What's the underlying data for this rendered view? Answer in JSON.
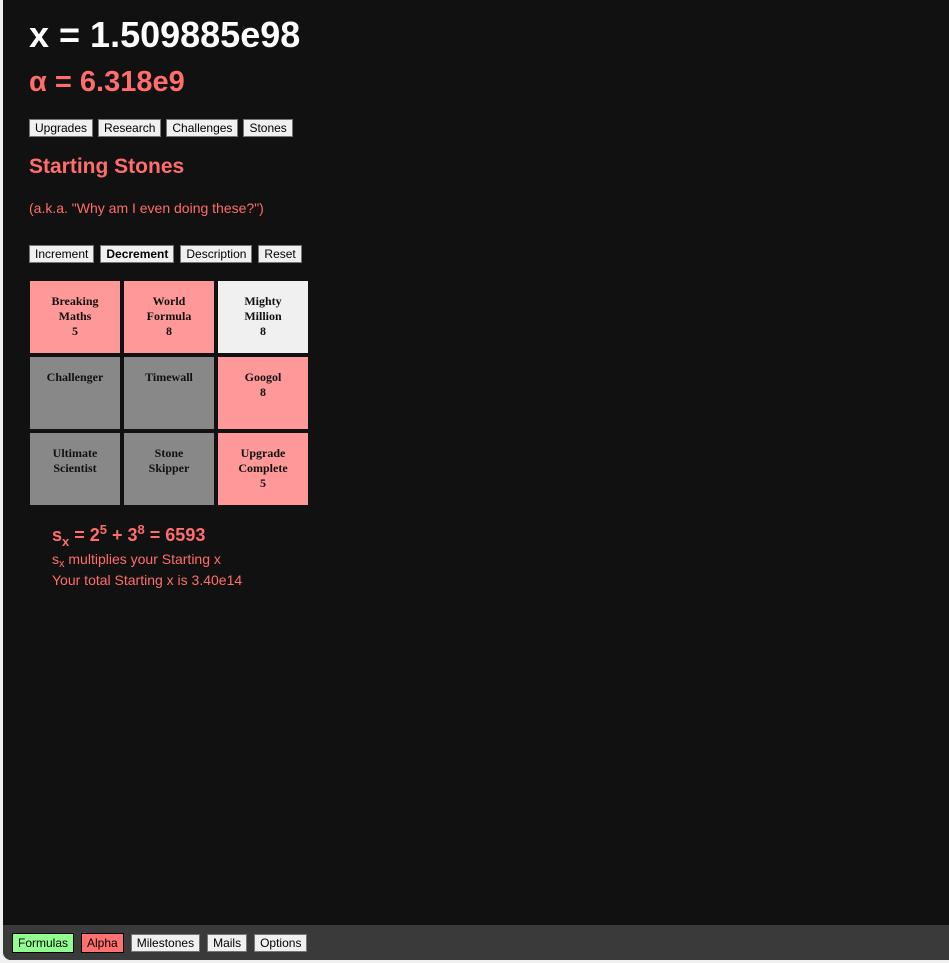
{
  "header": {
    "x_text": "x = 1.509885e98",
    "alpha_text": "α = 6.318e9"
  },
  "tabs": [
    {
      "label": "Upgrades"
    },
    {
      "label": "Research"
    },
    {
      "label": "Challenges"
    },
    {
      "label": "Stones"
    }
  ],
  "stones_page": {
    "title": "Starting Stones",
    "subtitle": "(a.k.a. \"Why am I even doing these?\")",
    "modes": [
      {
        "label": "Increment",
        "selected": false
      },
      {
        "label": "Decrement",
        "selected": true
      },
      {
        "label": "Description",
        "selected": false
      },
      {
        "label": "Reset",
        "selected": false
      }
    ],
    "stones": [
      {
        "name_line1": "Breaking",
        "name_line2": "Maths",
        "level": "5",
        "state": "active",
        "color": "#ff9898"
      },
      {
        "name_line1": "World",
        "name_line2": "Formula",
        "level": "8",
        "state": "active",
        "color": "#ff9898"
      },
      {
        "name_line1": "Mighty",
        "name_line2": "Million",
        "level": "8",
        "state": "maxed",
        "color": "#f0f0f0"
      },
      {
        "name_line1": "Challenger",
        "name_line2": "",
        "level": "",
        "state": "locked",
        "color": "#888888"
      },
      {
        "name_line1": "Timewall",
        "name_line2": "",
        "level": "",
        "state": "locked",
        "color": "#888888"
      },
      {
        "name_line1": "Googol",
        "name_line2": "",
        "level": "8",
        "state": "active",
        "color": "#ff9898"
      },
      {
        "name_line1": "Ultimate",
        "name_line2": "Scientist",
        "level": "",
        "state": "locked",
        "color": "#888888"
      },
      {
        "name_line1": "Stone",
        "name_line2": "Skipper",
        "level": "",
        "state": "locked",
        "color": "#888888"
      },
      {
        "name_line1": "Upgrade",
        "name_line2": "Complete",
        "level": "5",
        "state": "active",
        "color": "#ff9898"
      }
    ],
    "formula": {
      "var": "s",
      "var_sub": "x",
      "base1": "2",
      "exp1": "5",
      "base2": "3",
      "exp2": "8",
      "result": "6593",
      "line1_rest": "multiplies your Starting x",
      "line2": "Your total Starting x is 3.40e14"
    }
  },
  "bottom_bar": {
    "buttons": [
      {
        "label": "Formulas",
        "color": "#90ff90"
      },
      {
        "label": "Alpha",
        "color": "#ff7070"
      },
      {
        "label": "Milestones"
      },
      {
        "label": "Mails"
      },
      {
        "label": "Options"
      }
    ]
  }
}
